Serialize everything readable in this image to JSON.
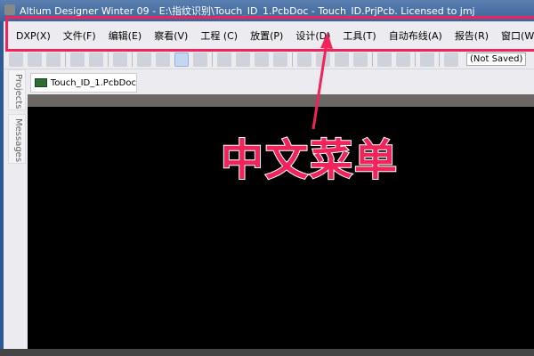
{
  "window": {
    "title": "Altium Designer Winter 09 - E:\\指纹识别\\Touch_ID_1.PcbDoc - Touch_ID.PrjPcb. Licensed to jmj"
  },
  "menu": [
    "DXP(X)",
    "文件(F)",
    "编辑(E)",
    "察看(V)",
    "工程 (C)",
    "放置(P)",
    "设计(D)",
    "工具(T)",
    "自动布线(A)",
    "报告(R)",
    "窗口(W)"
  ],
  "toolbar": {
    "status": "(Not Saved)"
  },
  "side_tabs": [
    "Projects",
    "Messages"
  ],
  "document_tab": "Touch_ID_1.PcbDoc",
  "annotation": {
    "text": "中文菜单",
    "color": "#f0245a"
  }
}
